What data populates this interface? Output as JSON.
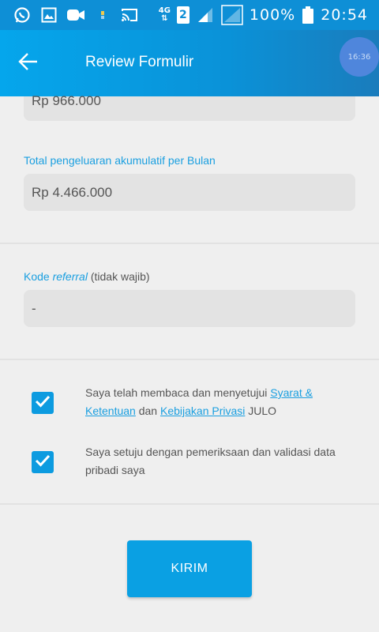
{
  "status_bar": {
    "network_type": "4G",
    "sim_slot": "2",
    "battery": "100%",
    "time": "20:54"
  },
  "app_bar": {
    "title": "Review Formulir",
    "time_badge": "16:36"
  },
  "form": {
    "partial_field_value": "Rp 966.000",
    "total_label": "Total pengeluaran akumulatif per Bulan",
    "total_value": "Rp 4.466.000",
    "referral_label_prefix": "Kode ",
    "referral_label_italic": "referral",
    "referral_label_suffix": " (tidak wajib)",
    "referral_value": "-"
  },
  "agreements": {
    "first": {
      "text_before": "Saya telah membaca dan menyetujui ",
      "link_terms": "Syarat & Ketentuan",
      "text_middle": " dan ",
      "link_privacy": "Kebijakan Privasi",
      "text_after": " JULO",
      "checked": true
    },
    "second": {
      "text": "Saya setuju dengan pemeriksaan dan validasi data pribadi saya",
      "checked": true
    }
  },
  "submit_label": "KIRIM",
  "colors": {
    "primary": "#0aa0e3",
    "status_bar": "#0e8fd6",
    "field_bg": "#e3e3e3",
    "page_bg": "#efefef"
  },
  "icons": {
    "status_left": [
      "whatsapp-icon",
      "gallery-icon",
      "video-call-icon",
      "dot-icon",
      "cast-icon"
    ],
    "status_right": [
      "signal-icon",
      "signal-empty-icon",
      "battery-icon"
    ],
    "back": "arrow-left-icon",
    "check": "checkmark-icon"
  }
}
